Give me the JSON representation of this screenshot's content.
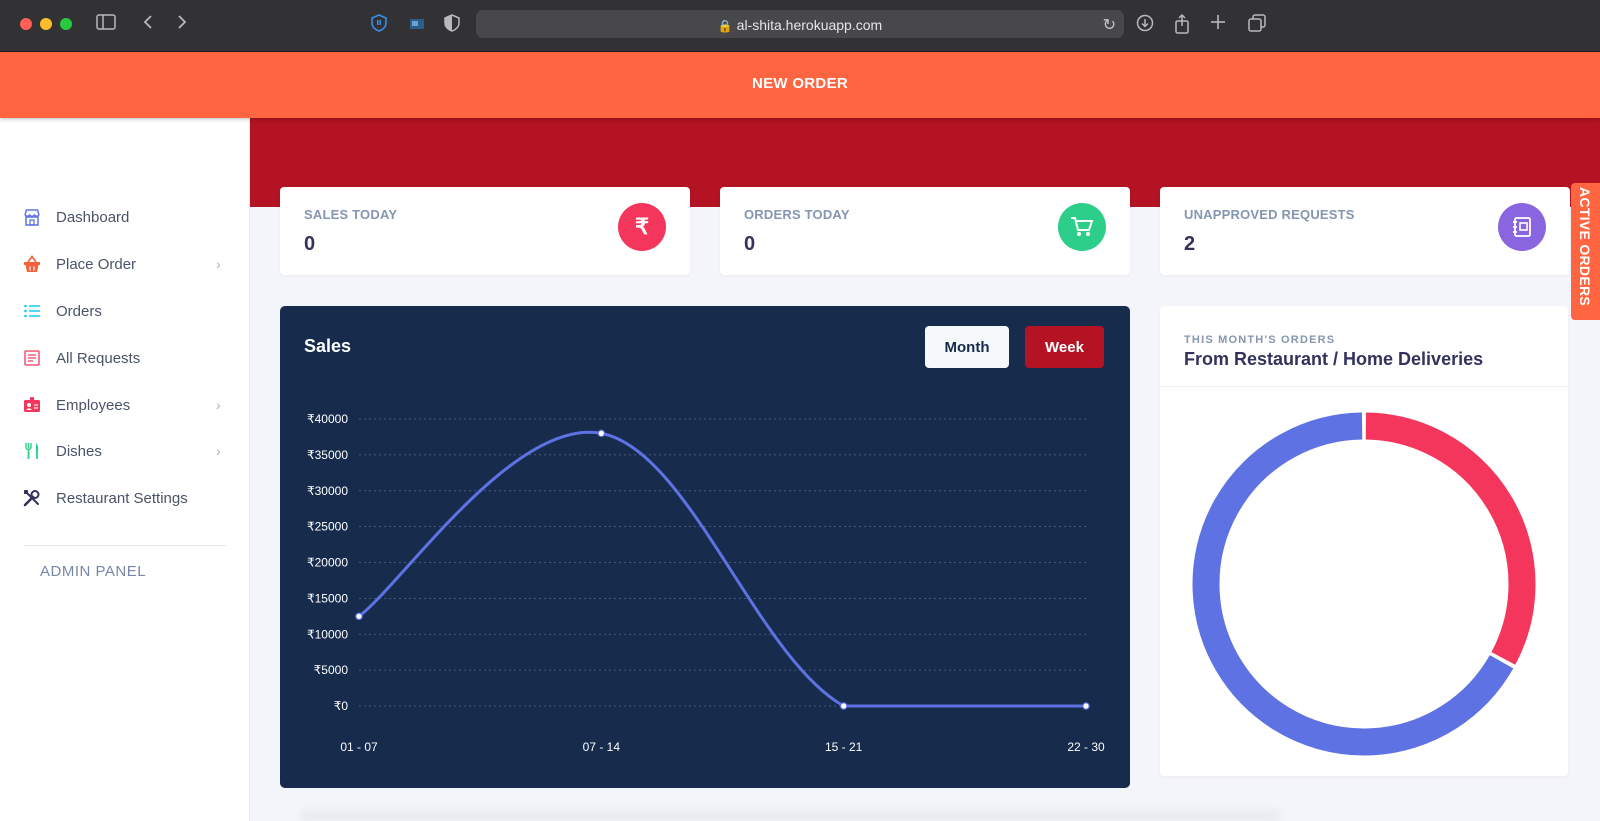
{
  "browser": {
    "url": "al-shita.herokuapp.com"
  },
  "banner": {
    "label": "NEW ORDER"
  },
  "sidebar": {
    "items": [
      {
        "label": "Dashboard",
        "icon": "store-icon",
        "has_submenu": false
      },
      {
        "label": "Place Order",
        "icon": "basket-icon",
        "has_submenu": true
      },
      {
        "label": "Orders",
        "icon": "list-icon",
        "has_submenu": false
      },
      {
        "label": "All Requests",
        "icon": "receipt-icon",
        "has_submenu": false
      },
      {
        "label": "Employees",
        "icon": "id-badge-icon",
        "has_submenu": true
      },
      {
        "label": "Dishes",
        "icon": "utensils-icon",
        "has_submenu": true
      },
      {
        "label": "Restaurant Settings",
        "icon": "tools-icon",
        "has_submenu": false
      }
    ],
    "section_label": "ADMIN PANEL"
  },
  "stats": [
    {
      "title": "SALES TODAY",
      "value": "0",
      "icon": "rupee-icon",
      "color": "#f5365c"
    },
    {
      "title": "ORDERS TODAY",
      "value": "0",
      "icon": "cart-icon",
      "color": "#2dce89"
    },
    {
      "title": "UNAPPROVED REQUESTS",
      "value": "2",
      "icon": "notebook-icon",
      "color": "#8965e0"
    }
  ],
  "sales_card": {
    "title": "Sales",
    "buttons": {
      "month": "Month",
      "week": "Week"
    }
  },
  "donut_card": {
    "eyebrow": "THIS MONTH'S ORDERS",
    "title": "From Restaurant / Home Deliveries"
  },
  "side_tab": {
    "label": "ACTIVE ORDERS"
  },
  "colors": {
    "accent_orange": "#ff6540",
    "brand_red": "#b31322",
    "navy": "#172b4d",
    "line_blue": "#5e72e4",
    "donut_red": "#f5365c",
    "donut_blue": "#5e72e4"
  },
  "chart_data": [
    {
      "type": "line",
      "title": "Sales",
      "categories": [
        "01 - 07",
        "07 - 14",
        "15 - 21",
        "22 - 30"
      ],
      "values": [
        12500,
        38000,
        0,
        0
      ],
      "yticks": [
        "₹0",
        "₹5000",
        "₹10000",
        "₹15000",
        "₹20000",
        "₹25000",
        "₹30000",
        "₹35000",
        "₹40000"
      ],
      "ylim": [
        0,
        40000
      ],
      "grid": true
    },
    {
      "type": "pie",
      "title": "From Restaurant / Home Deliveries",
      "values": [
        33,
        67
      ],
      "colors": [
        "#f5365c",
        "#5e72e4"
      ]
    }
  ]
}
